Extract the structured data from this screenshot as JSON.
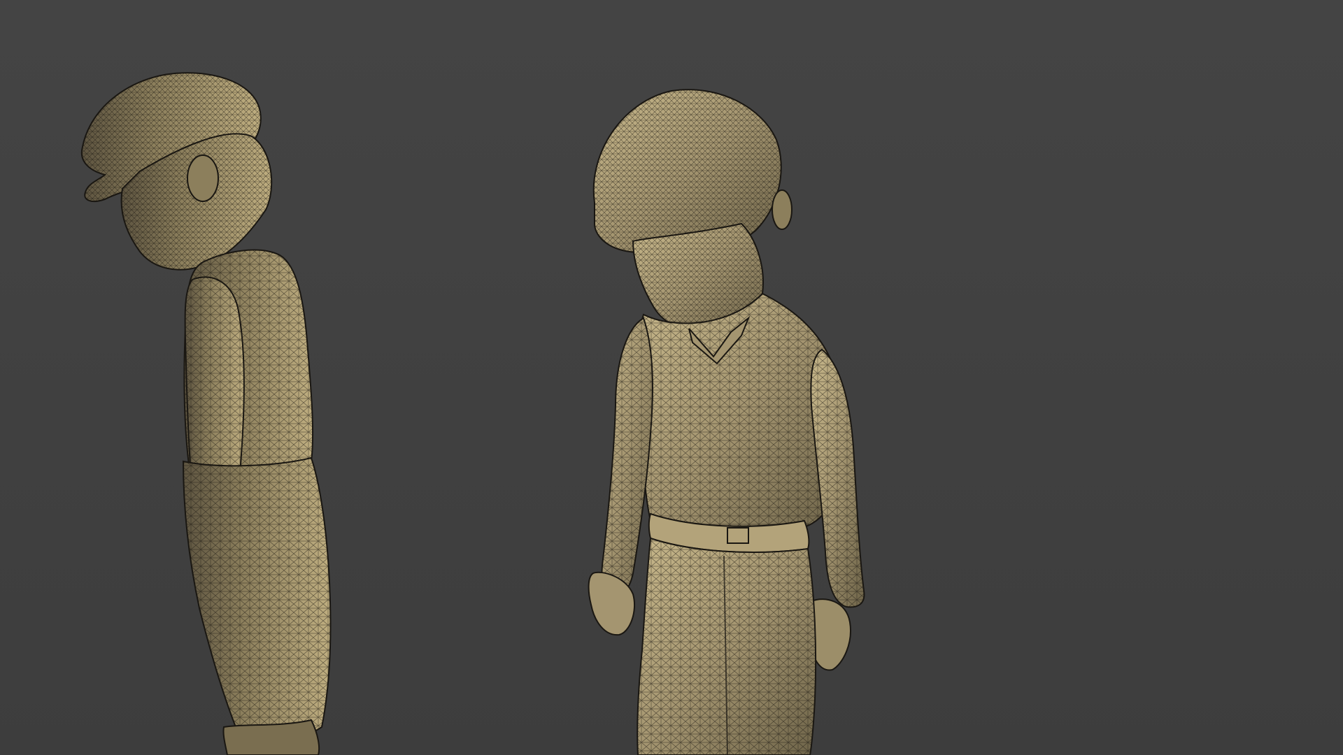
{
  "scene": {
    "background_color": "#414141",
    "mesh_color": "#8f815c",
    "mesh_highlight": "#c4b385",
    "wire_color": "#1a1712",
    "models": [
      {
        "name": "boy-statue-side-view"
      },
      {
        "name": "boy-statue-front-view"
      }
    ]
  }
}
